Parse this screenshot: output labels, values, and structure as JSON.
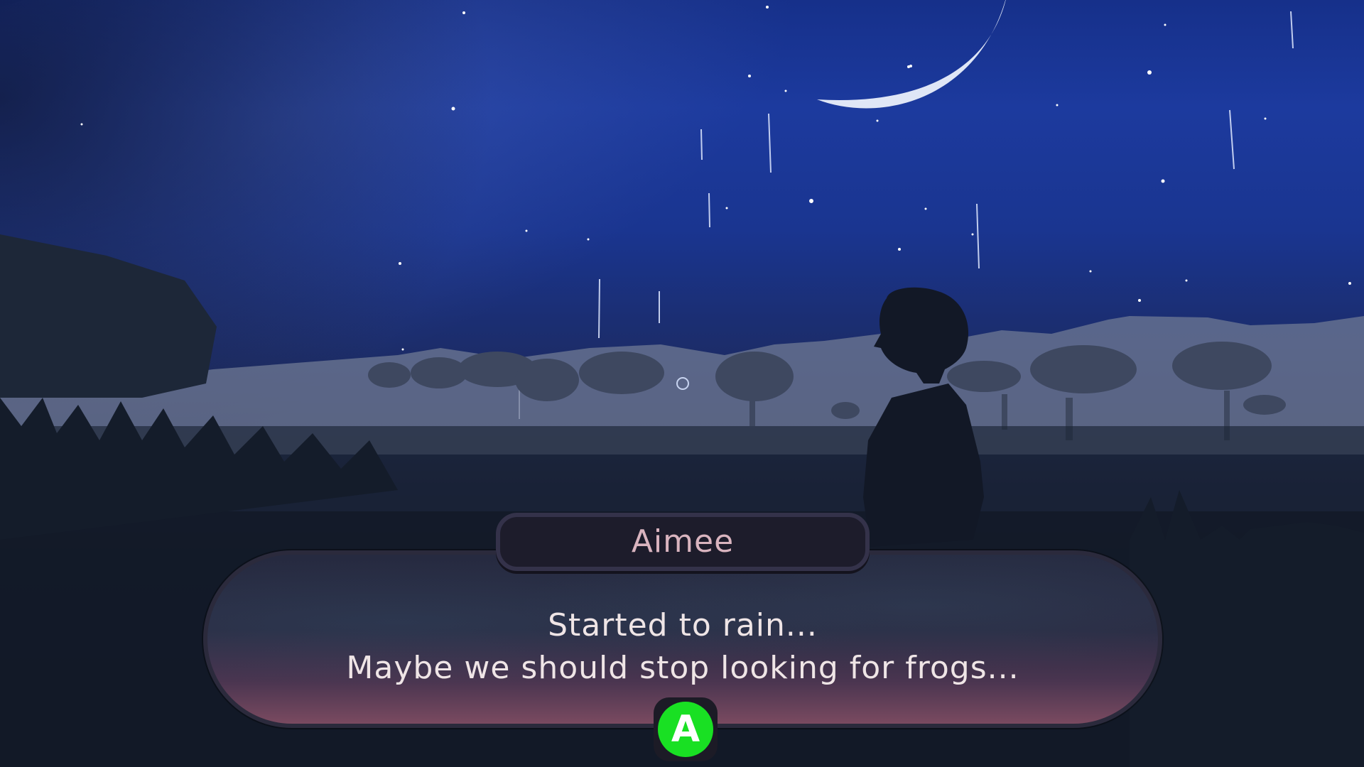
{
  "dialogue": {
    "speaker": "Aimee",
    "line1": "Started to rain...",
    "line2": "Maybe we should stop looking for frogs...",
    "advance_button": "A"
  },
  "colors": {
    "sky_top": "#16308a",
    "moon": "#dfe6f6",
    "advance_button": "#19e023",
    "speaker_name": "#d9b4bf",
    "dialogue_text": "#efe5e6"
  },
  "scene": {
    "time_of_day": "night",
    "weather": "rain",
    "icons": [
      "crescent-moon-icon",
      "stars",
      "raindrops",
      "character-silhouette",
      "trees",
      "grass"
    ]
  }
}
